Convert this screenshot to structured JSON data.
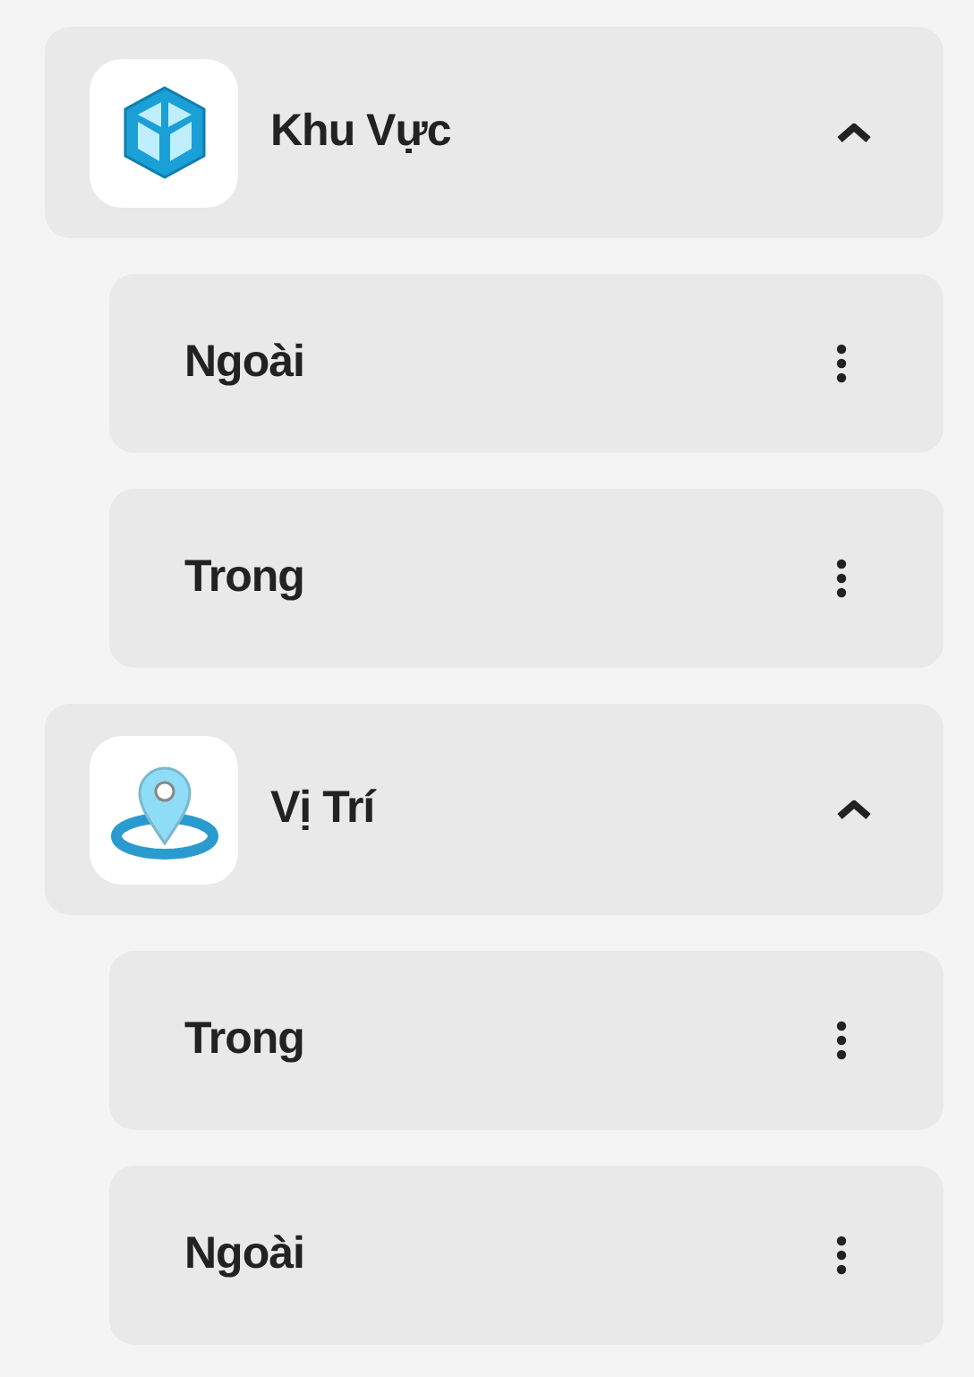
{
  "groups": [
    {
      "title": "Khu Vực",
      "kind": "cube",
      "expanded": true,
      "children": [
        {
          "label": "Ngoài"
        },
        {
          "label": "Trong"
        }
      ]
    },
    {
      "title": "Vị Trí",
      "kind": "pin",
      "expanded": true,
      "children": [
        {
          "label": "Trong"
        },
        {
          "label": "Ngoài"
        }
      ]
    }
  ]
}
